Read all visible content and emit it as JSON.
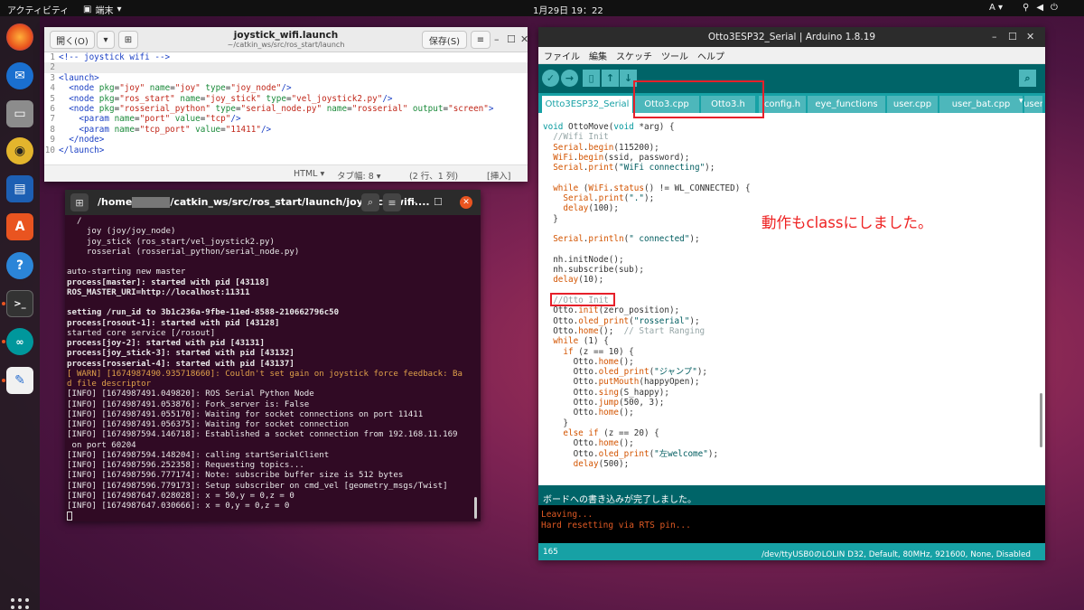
{
  "topbar": {
    "activities": "アクティビティ",
    "app_menu": "端末",
    "clock": "1月29日 19：22",
    "input_method": "A"
  },
  "gedit": {
    "open_button": "開く(O)",
    "title": "joystick_wifi.launch",
    "subtitle": "~/catkin_ws/src/ros_start/launch",
    "save_button": "保存(S)",
    "lines": [
      {
        "n": "1",
        "parts": [
          {
            "t": "<!-- joystick wifi -->",
            "c": "cm"
          }
        ]
      },
      {
        "n": "2",
        "parts": []
      },
      {
        "n": "3",
        "parts": [
          {
            "t": "<launch>",
            "c": "tg"
          }
        ]
      },
      {
        "n": "4",
        "parts": [
          {
            "t": "  <node ",
            "c": "tg"
          },
          {
            "t": "pkg",
            "c": "at"
          },
          {
            "t": "=",
            "c": ""
          },
          {
            "t": "\"joy\"",
            "c": "sv"
          },
          {
            "t": " name",
            "c": "at"
          },
          {
            "t": "=",
            "c": ""
          },
          {
            "t": "\"joy\"",
            "c": "sv"
          },
          {
            "t": " type",
            "c": "at"
          },
          {
            "t": "=",
            "c": ""
          },
          {
            "t": "\"joy_node\"",
            "c": "sv"
          },
          {
            "t": "/>",
            "c": "tg"
          }
        ]
      },
      {
        "n": "5",
        "parts": [
          {
            "t": "  <node ",
            "c": "tg"
          },
          {
            "t": "pkg",
            "c": "at"
          },
          {
            "t": "=",
            "c": ""
          },
          {
            "t": "\"ros_start\"",
            "c": "sv"
          },
          {
            "t": " name",
            "c": "at"
          },
          {
            "t": "=",
            "c": ""
          },
          {
            "t": "\"joy_stick\"",
            "c": "sv"
          },
          {
            "t": " type",
            "c": "at"
          },
          {
            "t": "=",
            "c": ""
          },
          {
            "t": "\"vel_joystick2.py\"",
            "c": "sv"
          },
          {
            "t": "/>",
            "c": "tg"
          }
        ]
      },
      {
        "n": "6",
        "parts": [
          {
            "t": "  <node ",
            "c": "tg"
          },
          {
            "t": "pkg",
            "c": "at"
          },
          {
            "t": "=",
            "c": ""
          },
          {
            "t": "\"rosserial_python\"",
            "c": "sv"
          },
          {
            "t": " type",
            "c": "at"
          },
          {
            "t": "=",
            "c": ""
          },
          {
            "t": "\"serial_node.py\"",
            "c": "sv"
          },
          {
            "t": " name",
            "c": "at"
          },
          {
            "t": "=",
            "c": ""
          },
          {
            "t": "\"rosserial\"",
            "c": "sv"
          },
          {
            "t": " output",
            "c": "at"
          },
          {
            "t": "=",
            "c": ""
          },
          {
            "t": "\"screen\"",
            "c": "sv"
          },
          {
            "t": ">",
            "c": "tg"
          }
        ]
      },
      {
        "n": "7",
        "parts": [
          {
            "t": "    <param ",
            "c": "tg"
          },
          {
            "t": "name",
            "c": "at"
          },
          {
            "t": "=",
            "c": ""
          },
          {
            "t": "\"port\"",
            "c": "sv"
          },
          {
            "t": " value",
            "c": "at"
          },
          {
            "t": "=",
            "c": ""
          },
          {
            "t": "\"tcp\"",
            "c": "sv"
          },
          {
            "t": "/>",
            "c": "tg"
          }
        ]
      },
      {
        "n": "8",
        "parts": [
          {
            "t": "    <param ",
            "c": "tg"
          },
          {
            "t": "name",
            "c": "at"
          },
          {
            "t": "=",
            "c": ""
          },
          {
            "t": "\"tcp_port\"",
            "c": "sv"
          },
          {
            "t": " value",
            "c": "at"
          },
          {
            "t": "=",
            "c": ""
          },
          {
            "t": "\"11411\"",
            "c": "sv"
          },
          {
            "t": "/>",
            "c": "tg"
          }
        ]
      },
      {
        "n": "9",
        "parts": [
          {
            "t": "  </node>",
            "c": "tg"
          }
        ]
      },
      {
        "n": "10",
        "parts": [
          {
            "t": "</launch>",
            "c": "tg"
          }
        ]
      }
    ],
    "status": {
      "lang": "HTML ▾",
      "tab": "タブ幅: 8 ▾",
      "pos": "(2 行、1 列)",
      "mode": "[挿入]"
    }
  },
  "terminal": {
    "title_prefix": "/home",
    "title_suffix": "/catkin_ws/src/ros_start/launch/joystick_wifi....",
    "lines": [
      {
        "t": "  /",
        "s": ""
      },
      {
        "t": "    joy (joy/joy_node)",
        "s": ""
      },
      {
        "t": "    joy_stick (ros_start/vel_joystick2.py)",
        "s": ""
      },
      {
        "t": "    rosserial (rosserial_python/serial_node.py)",
        "s": ""
      },
      {
        "t": "",
        "s": ""
      },
      {
        "t": "auto-starting new master",
        "s": ""
      },
      {
        "t": "process[master]: started with pid [43118]",
        "s": "b"
      },
      {
        "t": "ROS_MASTER_URI=http://localhost:11311",
        "s": "b"
      },
      {
        "t": "",
        "s": ""
      },
      {
        "t": "setting /run_id to 3b1c236a-9fbe-11ed-8588-210662796c50",
        "s": "b"
      },
      {
        "t": "process[rosout-1]: started with pid [43128]",
        "s": "b"
      },
      {
        "t": "started core service [/rosout]",
        "s": ""
      },
      {
        "t": "process[joy-2]: started with pid [43131]",
        "s": "b"
      },
      {
        "t": "process[joy_stick-3]: started with pid [43132]",
        "s": "b"
      },
      {
        "t": "process[rosserial-4]: started with pid [43137]",
        "s": "b"
      },
      {
        "t": "[ WARN] [1674987490.935718660]: Couldn't set gain on joystick force feedback: Ba",
        "s": "w"
      },
      {
        "t": "d file descriptor",
        "s": "w"
      },
      {
        "t": "[INFO] [1674987491.049820]: ROS Serial Python Node",
        "s": ""
      },
      {
        "t": "[INFO] [1674987491.053876]: Fork_server is: False",
        "s": ""
      },
      {
        "t": "[INFO] [1674987491.055170]: Waiting for socket connections on port 11411",
        "s": ""
      },
      {
        "t": "[INFO] [1674987491.056375]: Waiting for socket connection",
        "s": ""
      },
      {
        "t": "[INFO] [1674987594.146718]: Established a socket connection from 192.168.11.169",
        "s": ""
      },
      {
        "t": " on port 60204",
        "s": ""
      },
      {
        "t": "[INFO] [1674987594.148204]: calling startSerialClient",
        "s": ""
      },
      {
        "t": "[INFO] [1674987596.252358]: Requesting topics...",
        "s": ""
      },
      {
        "t": "[INFO] [1674987596.777174]: Note: subscribe buffer size is 512 bytes",
        "s": ""
      },
      {
        "t": "[INFO] [1674987596.779173]: Setup subscriber on cmd_vel [geometry_msgs/Twist]",
        "s": ""
      },
      {
        "t": "[INFO] [1674987647.028028]: x = 50,y = 0,z = 0",
        "s": ""
      },
      {
        "t": "[INFO] [1674987647.030666]: x = 0,y = 0,z = 0",
        "s": ""
      }
    ]
  },
  "arduino": {
    "title": "Otto3ESP32_Serial | Arduino 1.8.19",
    "menu": [
      "ファイル",
      "編集",
      "スケッチ",
      "ツール",
      "ヘルプ"
    ],
    "tabs": [
      "Otto3ESP32_Serial",
      "Otto3.cpp",
      "Otto3.h",
      "config.h",
      "eye_functions",
      "user.cpp",
      "user_bat.cpp",
      "user"
    ],
    "code": [
      [
        {
          "t": "void ",
          "c": "ty"
        },
        {
          "t": "OttoMove(",
          "c": ""
        },
        {
          "t": "void",
          "c": "ty"
        },
        {
          "t": " *arg) {",
          "c": ""
        }
      ],
      [
        {
          "t": "  //Wifi Init",
          "c": "co"
        }
      ],
      [
        {
          "t": "  ",
          "c": ""
        },
        {
          "t": "Serial",
          "c": "kw"
        },
        {
          "t": ".",
          "c": ""
        },
        {
          "t": "begin",
          "c": "fn"
        },
        {
          "t": "(115200);",
          "c": ""
        }
      ],
      [
        {
          "t": "  ",
          "c": ""
        },
        {
          "t": "WiFi",
          "c": "kw"
        },
        {
          "t": ".",
          "c": ""
        },
        {
          "t": "begin",
          "c": "fn"
        },
        {
          "t": "(ssid, password);",
          "c": ""
        }
      ],
      [
        {
          "t": "  ",
          "c": ""
        },
        {
          "t": "Serial",
          "c": "kw"
        },
        {
          "t": ".",
          "c": ""
        },
        {
          "t": "print",
          "c": "fn"
        },
        {
          "t": "(",
          "c": ""
        },
        {
          "t": "\"WiFi connecting\"",
          "c": "st"
        },
        {
          "t": ");",
          "c": ""
        }
      ],
      [],
      [
        {
          "t": "  ",
          "c": ""
        },
        {
          "t": "while",
          "c": "kw"
        },
        {
          "t": " (",
          "c": ""
        },
        {
          "t": "WiFi",
          "c": "kw"
        },
        {
          "t": ".",
          "c": ""
        },
        {
          "t": "status",
          "c": "fn"
        },
        {
          "t": "() != WL_CONNECTED) {",
          "c": ""
        }
      ],
      [
        {
          "t": "    ",
          "c": ""
        },
        {
          "t": "Serial",
          "c": "kw"
        },
        {
          "t": ".",
          "c": ""
        },
        {
          "t": "print",
          "c": "fn"
        },
        {
          "t": "(",
          "c": ""
        },
        {
          "t": "\".\"",
          "c": "st"
        },
        {
          "t": ");",
          "c": ""
        }
      ],
      [
        {
          "t": "    ",
          "c": ""
        },
        {
          "t": "delay",
          "c": "fn"
        },
        {
          "t": "(100);",
          "c": ""
        }
      ],
      [
        {
          "t": "  }",
          "c": ""
        }
      ],
      [],
      [
        {
          "t": "  ",
          "c": ""
        },
        {
          "t": "Serial",
          "c": "kw"
        },
        {
          "t": ".",
          "c": ""
        },
        {
          "t": "println",
          "c": "fn"
        },
        {
          "t": "(",
          "c": ""
        },
        {
          "t": "\" connected\"",
          "c": "st"
        },
        {
          "t": ");",
          "c": ""
        }
      ],
      [],
      [
        {
          "t": "  nh.initNode();",
          "c": ""
        }
      ],
      [
        {
          "t": "  nh.subscribe(sub);",
          "c": ""
        }
      ],
      [
        {
          "t": "  ",
          "c": ""
        },
        {
          "t": "delay",
          "c": "fn"
        },
        {
          "t": "(10);",
          "c": ""
        }
      ],
      [],
      [
        {
          "t": "  //Otto Init",
          "c": "co"
        }
      ],
      [
        {
          "t": "  Otto.",
          "c": ""
        },
        {
          "t": "init",
          "c": "fn"
        },
        {
          "t": "(zero_position);",
          "c": ""
        }
      ],
      [
        {
          "t": "  Otto.",
          "c": ""
        },
        {
          "t": "oled_print",
          "c": "fn"
        },
        {
          "t": "(",
          "c": ""
        },
        {
          "t": "\"rosserial\"",
          "c": "st"
        },
        {
          "t": ");",
          "c": ""
        }
      ],
      [
        {
          "t": "  Otto.",
          "c": ""
        },
        {
          "t": "home",
          "c": "fn"
        },
        {
          "t": "();  ",
          "c": ""
        },
        {
          "t": "// Start Ranging",
          "c": "co"
        }
      ],
      [
        {
          "t": "  ",
          "c": ""
        },
        {
          "t": "while",
          "c": "kw"
        },
        {
          "t": " (1) {",
          "c": ""
        }
      ],
      [
        {
          "t": "    ",
          "c": ""
        },
        {
          "t": "if",
          "c": "kw"
        },
        {
          "t": " (z == 10) {",
          "c": ""
        }
      ],
      [
        {
          "t": "      Otto.",
          "c": ""
        },
        {
          "t": "home",
          "c": "fn"
        },
        {
          "t": "();",
          "c": ""
        }
      ],
      [
        {
          "t": "      Otto.",
          "c": ""
        },
        {
          "t": "oled_print",
          "c": "fn"
        },
        {
          "t": "(",
          "c": ""
        },
        {
          "t": "\"ジャンプ\"",
          "c": "st"
        },
        {
          "t": ");",
          "c": ""
        }
      ],
      [
        {
          "t": "      Otto.",
          "c": ""
        },
        {
          "t": "putMouth",
          "c": "fn"
        },
        {
          "t": "(happyOpen);",
          "c": ""
        }
      ],
      [
        {
          "t": "      Otto.",
          "c": ""
        },
        {
          "t": "sing",
          "c": "fn"
        },
        {
          "t": "(S_happy);",
          "c": ""
        }
      ],
      [
        {
          "t": "      Otto.",
          "c": ""
        },
        {
          "t": "jump",
          "c": "fn"
        },
        {
          "t": "(500, 3);",
          "c": ""
        }
      ],
      [
        {
          "t": "      Otto.",
          "c": ""
        },
        {
          "t": "home",
          "c": "fn"
        },
        {
          "t": "();",
          "c": ""
        }
      ],
      [
        {
          "t": "    }",
          "c": ""
        }
      ],
      [
        {
          "t": "    ",
          "c": ""
        },
        {
          "t": "else if",
          "c": "kw"
        },
        {
          "t": " (z == 20) {",
          "c": ""
        }
      ],
      [
        {
          "t": "      Otto.",
          "c": ""
        },
        {
          "t": "home",
          "c": "fn"
        },
        {
          "t": "();",
          "c": ""
        }
      ],
      [
        {
          "t": "      Otto.",
          "c": ""
        },
        {
          "t": "oled_print",
          "c": "fn"
        },
        {
          "t": "(",
          "c": ""
        },
        {
          "t": "\"左welcome\"",
          "c": "st"
        },
        {
          "t": ");",
          "c": ""
        }
      ],
      [
        {
          "t": "      ",
          "c": ""
        },
        {
          "t": "delay",
          "c": "fn"
        },
        {
          "t": "(500);",
          "c": ""
        }
      ]
    ],
    "message": "ボードへの書き込みが完了しました。",
    "console": [
      "Leaving...",
      "Hard resetting via RTS pin..."
    ],
    "footer_line": "165",
    "footer_board": "/dev/ttyUSB0のLOLIN D32, Default, 80MHz, 921600, None, Disabled"
  },
  "annotation": "動作もclassにしました。",
  "colors": {
    "arduino_teal": "#006468",
    "arduino_tab": "#17a1a5",
    "highlight_red": "#e6202a",
    "ubuntu_orange": "#e95420"
  }
}
